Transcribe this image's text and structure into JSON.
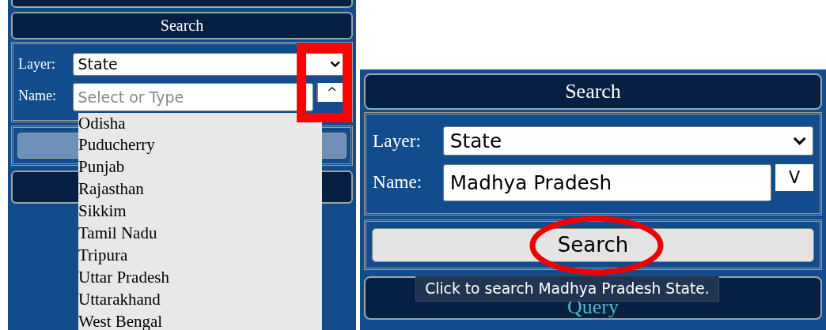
{
  "panels": [
    {
      "top_edge": true,
      "header": "Search",
      "layer": {
        "label": "Layer:",
        "value": "State"
      },
      "name": {
        "label": "Name:",
        "placeholder": "Select or Type",
        "toggle": "^",
        "expanded": true
      },
      "options": [
        "Odisha",
        "Puducherry",
        "Punjab",
        "Rajasthan",
        "Sikkim",
        "Tamil Nadu",
        "Tripura",
        "Uttar Pradesh",
        "Uttarakhand",
        "West Bengal"
      ],
      "search_button": {
        "disabled": true
      },
      "annotation": {
        "kind": "rectangle"
      }
    },
    {
      "top_edge": false,
      "header": "Search",
      "layer": {
        "label": "Layer:",
        "value": "State"
      },
      "name": {
        "label": "Name:",
        "value": "Madhya Pradesh",
        "toggle": "V",
        "expanded": false
      },
      "search_button": {
        "label": "Search",
        "disabled": false
      },
      "tooltip": "Click to search Madhya Pradesh State.",
      "query_header": {
        "label": "Query"
      },
      "annotation": {
        "kind": "ellipse"
      }
    }
  ]
}
